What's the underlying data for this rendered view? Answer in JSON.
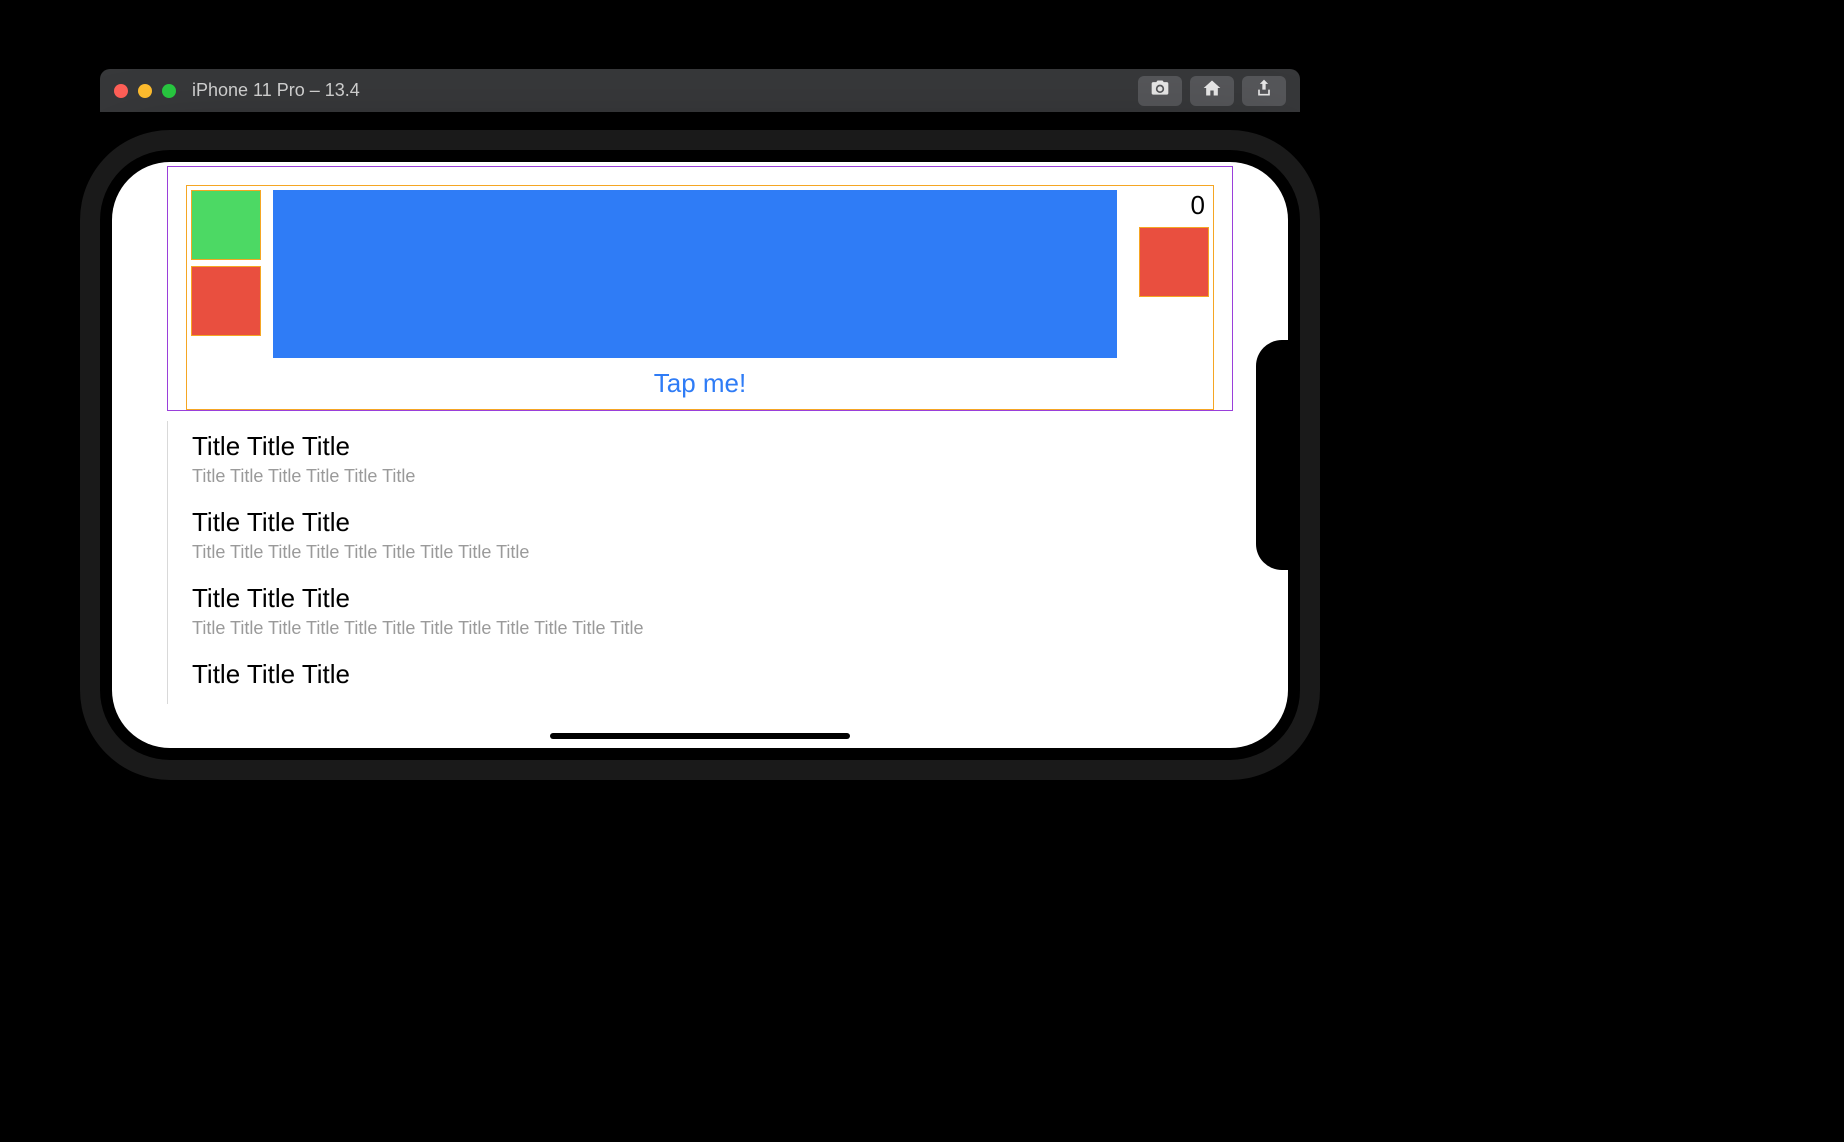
{
  "sim": {
    "title": "iPhone 11 Pro – 13.4",
    "buttons": {
      "screenshot": "Screenshot",
      "home": "Home",
      "share": "Share"
    }
  },
  "header": {
    "counter": "0",
    "tap_label": "Tap me!"
  },
  "list": [
    {
      "title": "Title Title Title",
      "subtitle": "Title Title Title  Title Title Title"
    },
    {
      "title": "Title Title Title",
      "subtitle": "Title Title Title  Title Title Title  Title Title Title"
    },
    {
      "title": "Title Title Title",
      "subtitle": "Title Title Title  Title Title Title  Title Title Title  Title Title Title"
    },
    {
      "title": "Title Title Title",
      "subtitle": ""
    }
  ]
}
